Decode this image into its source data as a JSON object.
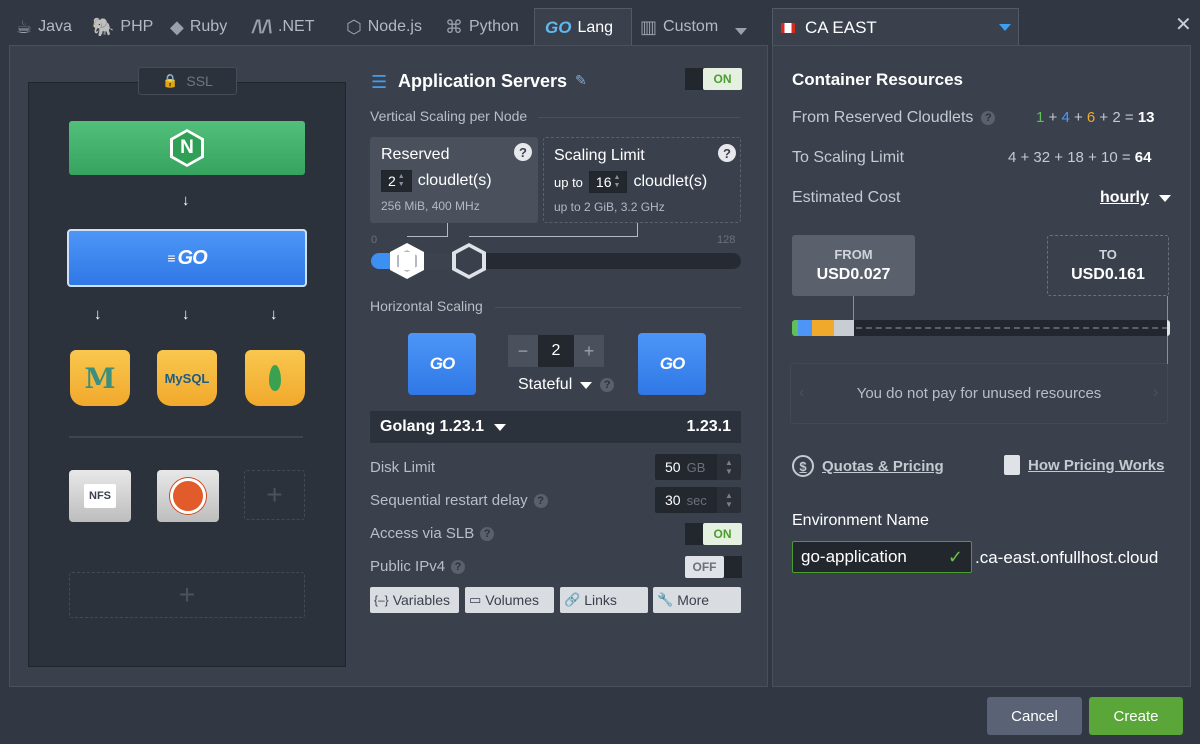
{
  "tabs": [
    {
      "label": "Java",
      "icon": "java-icon"
    },
    {
      "label": "PHP",
      "icon": "php-elephant-icon"
    },
    {
      "label": "Ruby",
      "icon": "ruby-icon"
    },
    {
      "label": ".NET",
      "icon": "dotnet-icon"
    },
    {
      "label": "Node.js",
      "icon": "nodejs-icon"
    },
    {
      "label": "Python",
      "icon": "python-icon"
    },
    {
      "label": "Lang",
      "icon": "go-logo-icon",
      "active": true,
      "logo_text": "GO"
    },
    {
      "label": "Custom",
      "icon": "custom-grid-icon"
    }
  ],
  "region": {
    "label": "CA EAST",
    "flag": "canada-flag-icon"
  },
  "topology": {
    "ssl_label": "SSL",
    "balancer_icon": "N",
    "appserver_label": "GO",
    "databases": [
      "mariadb-icon",
      "mysql-icon",
      "mongodb-icon"
    ],
    "mysql_text": "MySQL",
    "storage_label": "NFS",
    "vps": "ubuntu-icon"
  },
  "app_servers": {
    "title": "Application Servers",
    "toggle": "ON",
    "vertical_label": "Vertical Scaling per Node",
    "reserved": {
      "title": "Reserved",
      "value": "2",
      "unit": "cloudlet(s)",
      "spec": "256 MiB, 400 MHz"
    },
    "limit": {
      "title": "Scaling Limit",
      "prefix": "up to",
      "value": "16",
      "unit": "cloudlet(s)",
      "spec": "up to 2 GiB, 3.2 GHz"
    },
    "slider": {
      "min": "0",
      "max": "128",
      "reserved": 2,
      "limit": 16
    },
    "horizontal_label": "Horizontal Scaling",
    "node_count": "2",
    "mode": "Stateful",
    "version_name": "Golang 1.23.1",
    "version_value": "1.23.1",
    "disk_label": "Disk Limit",
    "disk_value": "50",
    "disk_unit": "GB",
    "restart_label": "Sequential restart delay",
    "restart_value": "30",
    "restart_unit": "sec",
    "slb_label": "Access via SLB",
    "slb_toggle": "ON",
    "ipv4_label": "Public IPv4",
    "ipv4_toggle": "OFF",
    "buttons": {
      "variables": "Variables",
      "volumes": "Volumes",
      "links": "Links",
      "more": "More"
    }
  },
  "resources": {
    "title": "Container Resources",
    "reserved_label": "From Reserved Cloudlets",
    "reserved_parts": [
      "1",
      "4",
      "6",
      "2"
    ],
    "reserved_total": "13",
    "limit_label": "To Scaling Limit",
    "limit_expr": "4 + 32 + 18 + 10 =",
    "limit_total": "64",
    "cost_label": "Estimated Cost",
    "cost_period": "hourly",
    "from_label": "FROM",
    "from_value": "USD0.027",
    "to_label": "TO",
    "to_value": "USD0.161",
    "info": "You do not pay for unused resources",
    "quotas_link": "Quotas & Pricing",
    "pricing_link": "How Pricing Works",
    "env_label": "Environment Name",
    "env_value": "go-application",
    "env_domain": ".ca-east.onfullhost.cloud"
  },
  "footer": {
    "cancel": "Cancel",
    "create": "Create"
  },
  "colors": {
    "accent_blue": "#2f78e6",
    "accent_green": "#4a9e2e",
    "create_btn": "#5aa638"
  }
}
